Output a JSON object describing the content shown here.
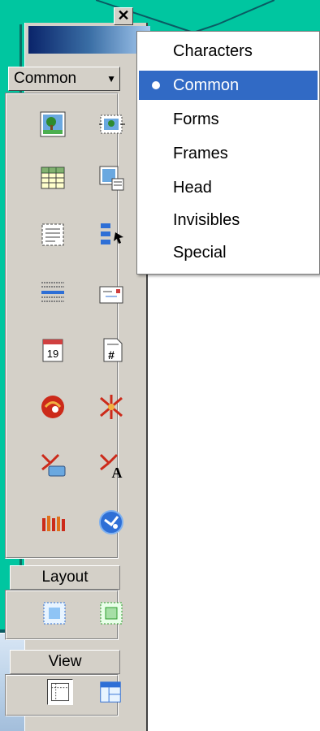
{
  "palette": {
    "close_glyph": "✕",
    "category_current": "Common",
    "sections": {
      "layout_label": "Layout",
      "view_label": "View"
    },
    "icons": [
      "image-icon",
      "rollover-image-icon",
      "table-icon",
      "tabular-data-icon",
      "layer-icon",
      "navigation-bar-icon",
      "horizontal-rule-icon",
      "email-link-icon",
      "date-icon",
      "server-side-include-icon",
      "shockwave-icon",
      "flash-icon",
      "flash-button-icon",
      "flash-text-icon",
      "generator-icon",
      "fireworks-html-icon"
    ]
  },
  "menu": {
    "items": [
      {
        "label": "Characters",
        "selected": false
      },
      {
        "label": "Common",
        "selected": true
      },
      {
        "label": "Forms",
        "selected": false
      },
      {
        "label": "Frames",
        "selected": false
      },
      {
        "label": "Head",
        "selected": false
      },
      {
        "label": "Invisibles",
        "selected": false
      },
      {
        "label": "Special",
        "selected": false
      }
    ]
  },
  "colors": {
    "teal": "#00c6a0",
    "selection": "#316ac5",
    "face": "#d4d0c8"
  }
}
